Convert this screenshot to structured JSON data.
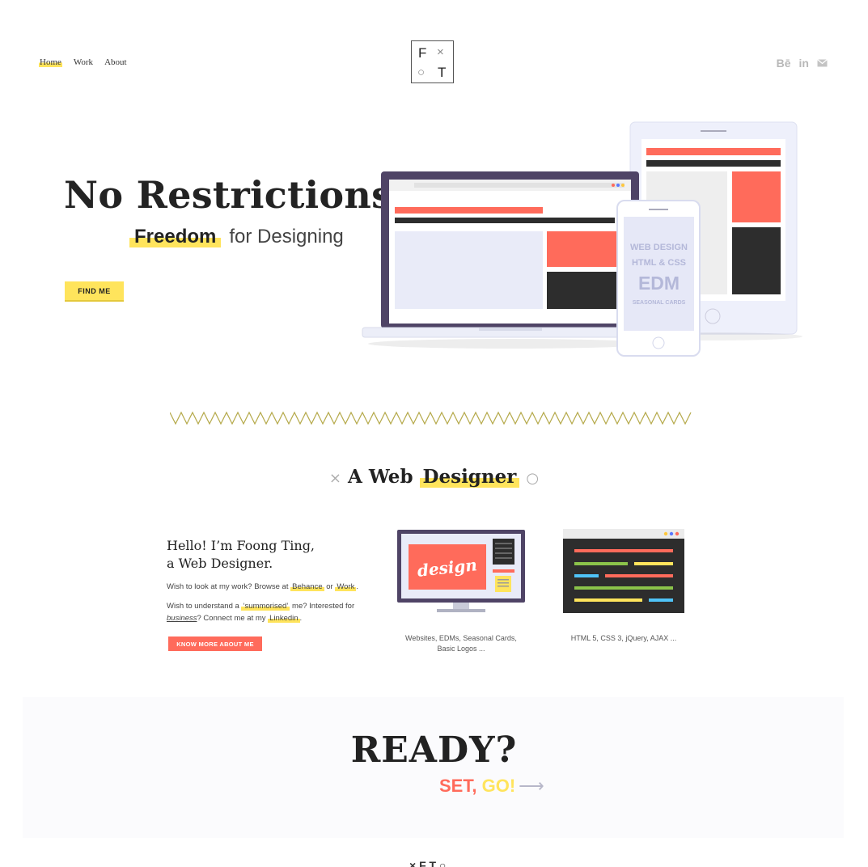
{
  "nav": {
    "items": [
      "Home",
      "Work",
      "About"
    ],
    "active": "Home"
  },
  "logo": {
    "top_left": "F",
    "top_right": "×",
    "bottom_left": "○",
    "bottom_right": "T"
  },
  "social": {
    "behance": "Bē",
    "linkedin": "in",
    "mail_icon": "mail-icon"
  },
  "hero": {
    "title": "No Restrictions.",
    "sub_highlight": "Freedom",
    "sub_rest": "for Designing",
    "button": "FIND ME"
  },
  "devices": {
    "phone_lines": [
      "WEB DESIGN",
      "HTML & CSS",
      "EDM",
      "SEASONAL CARDS"
    ]
  },
  "section": {
    "mark_left": "×",
    "title_plain": "A Web",
    "title_highlight": "Designer",
    "mark_right": "○"
  },
  "intro": {
    "hello_line1": "Hello! I’m Foong Ting,",
    "hello_line2": "a Web Designer.",
    "p1_prefix": "Wish to look at my work? Browse at",
    "p1_link1": "Behance",
    "p1_mid": "or",
    "p1_link2": "Work",
    "p1_suffix": ".",
    "p2_a": "Wish to understand a",
    "p2_link1": "‘summorised’",
    "p2_b": "me? Interested for",
    "p2_italic": "business",
    "p2_c": "? Connect me at my",
    "p2_link2": "Linkedin",
    "p2_d": ".",
    "button": "KNOW MORE ABOUT ME"
  },
  "cards": {
    "design_word": "design",
    "design_caption_1": "Websites, EDMs, Seasonal Cards,",
    "design_caption_2": "Basic Logos ...",
    "code_caption": "HTML 5, CSS 3, jQuery, AJAX ..."
  },
  "cta": {
    "ready": "READY?",
    "set": "SET,",
    "go": "GO!",
    "arrow": "⟶"
  },
  "footer": {
    "logo_text": "× F T ○"
  },
  "colors": {
    "yellow": "#ffe45c",
    "red": "#ff6b5b",
    "dark": "#2d2d2d",
    "purple": "#4f4466"
  }
}
